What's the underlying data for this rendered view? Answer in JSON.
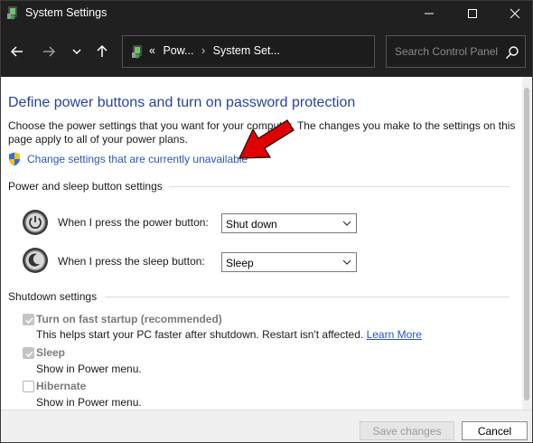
{
  "window": {
    "title": "System Settings",
    "controls": {
      "minimize": "minimize",
      "maximize": "maximize",
      "close": "close"
    }
  },
  "nav": {
    "back_icon": "arrow-left-icon",
    "forward_icon": "arrow-right-icon",
    "recent_icon": "chevron-down-icon",
    "up_icon": "arrow-up-icon",
    "breadcrumb": {
      "overflow": "«",
      "items": [
        "Pow...",
        "System Set..."
      ],
      "separator": "›"
    },
    "search_placeholder": "Search Control Panel"
  },
  "main": {
    "title": "Define power buttons and turn on password protection",
    "description": "Choose the power settings that you want for your computer. The changes you make to the settings on this page apply to all of your power plans.",
    "change_link": "Change settings that are currently unavailable",
    "power_section": {
      "heading": "Power and sleep button settings",
      "rows": [
        {
          "label": "When I press the power button:",
          "value": "Shut down"
        },
        {
          "label": "When I press the sleep button:",
          "value": "Sleep"
        }
      ]
    },
    "shutdown_section": {
      "heading": "Shutdown settings",
      "options": [
        {
          "label": "Turn on fast startup (recommended)",
          "checked": true,
          "sub": "This helps start your PC faster after shutdown. Restart isn't affected.",
          "link": "Learn More"
        },
        {
          "label": "Sleep",
          "checked": true,
          "sub": "Show in Power menu."
        },
        {
          "label": "Hibernate",
          "checked": false,
          "sub": "Show in Power menu."
        }
      ]
    }
  },
  "footer": {
    "save_label": "Save changes",
    "cancel_label": "Cancel"
  },
  "colors": {
    "titlebar": "#202020",
    "link": "#2a55b8",
    "heading": "#26459a",
    "annotation_arrow": "#e00000"
  }
}
